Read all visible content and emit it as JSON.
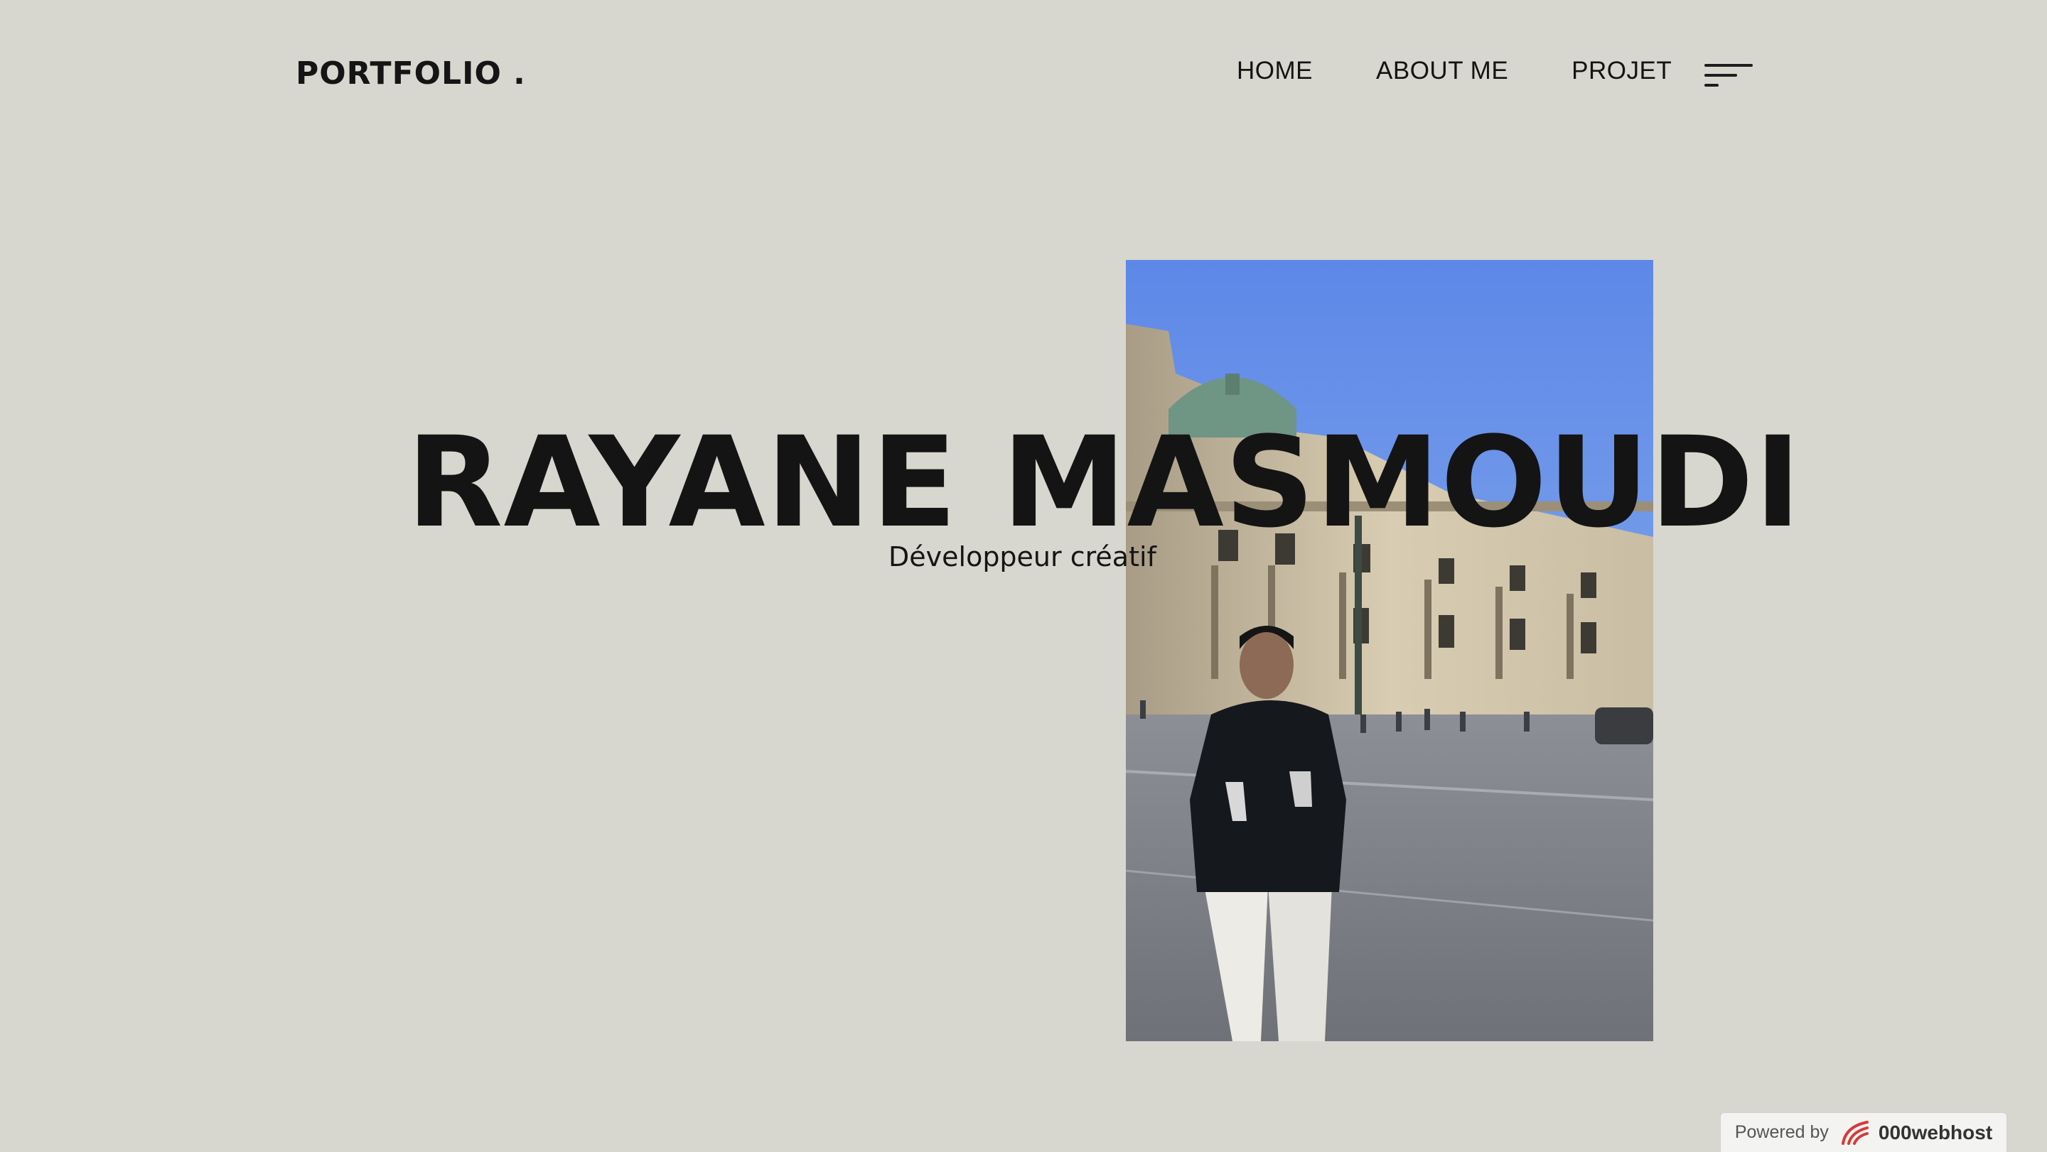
{
  "header": {
    "logo": "PORTFOLIO .",
    "nav": [
      {
        "label": "HOME"
      },
      {
        "label": "ABOUT ME"
      },
      {
        "label": "PROJET"
      }
    ],
    "menu_icon": "hamburger-menu-icon"
  },
  "hero": {
    "name": "RAYANE MASMOUDI",
    "subtitle": "Développeur créatif",
    "photo_icon": "portrait-photo"
  },
  "badge": {
    "powered_by": "Powered by",
    "brand": "000webhost",
    "brand_icon": "000webhost-logo-icon"
  },
  "colors": {
    "background": "#d8d7cf",
    "text": "#141414",
    "sky": "#5f8ae6",
    "badge_red": "#d43b3b"
  }
}
